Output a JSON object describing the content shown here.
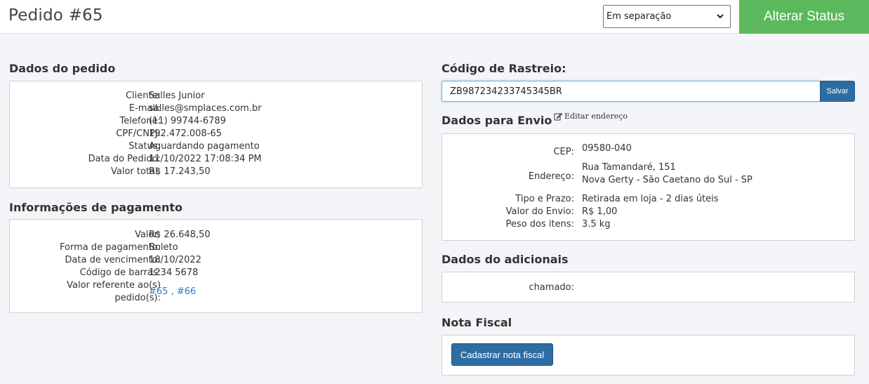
{
  "header": {
    "title": "Pedido #65",
    "status_selected": "Em separação",
    "status_button": "Alterar Status"
  },
  "order_data": {
    "title": "Dados do pedido",
    "rows": [
      {
        "label": "Cliente:",
        "value": "Salles Junior"
      },
      {
        "label": "E-mail:",
        "value": "salles@smplaces.com.br"
      },
      {
        "label": "Telefone:",
        "value": "(11) 99744-6789"
      },
      {
        "label": "CPF/CNPJ:",
        "value": "192.472.008-65"
      },
      {
        "label": "Status:",
        "value": "Aguardando pagamento"
      },
      {
        "label": "Data do Pedido:",
        "value": "11/10/2022 17:08:34 PM"
      },
      {
        "label": "Valor total:",
        "value": "R$ 17.243,50"
      }
    ]
  },
  "payment": {
    "title": "Informações de pagamento",
    "rows": [
      {
        "label": "Valor:",
        "value": "R$ 26.648,50"
      },
      {
        "label": "Forma de pagamento:",
        "value": "Boleto"
      },
      {
        "label": "Data de vencimento:",
        "value": "18/10/2022"
      },
      {
        "label": "Código de barras:",
        "value": "1234 5678"
      }
    ],
    "ref_label_1": "Valor referente ao(s)",
    "ref_label_2": "pedido(s):",
    "ref_link_1": "#65",
    "ref_sep": ",",
    "ref_link_2": "#66"
  },
  "tracking": {
    "title": "Código de Rastreio:",
    "value": "ZB987234233745345BR",
    "save_label": "Salvar"
  },
  "shipping": {
    "title": "Dados para Envio",
    "edit_label": "Editar endereço",
    "cep_label": "CEP:",
    "cep_value": "09580-040",
    "address_label": "Endereço:",
    "address_line1": "Rua Tamandaré, 151",
    "address_line2": "Nova Gerty - São Caetano do Sul - SP",
    "type_label": "Tipo e Prazo:",
    "type_value": "Retirada em loja - 2 dias úteis",
    "cost_label": "Valor do Envio:",
    "cost_value": "R$ 1,00",
    "weight_label": "Peso dos itens:",
    "weight_value": "3.5 kg"
  },
  "additional": {
    "title": "Dados do adicionais",
    "label": "chamado:",
    "value": ""
  },
  "invoice": {
    "title": "Nota Fiscal",
    "button_label": "Cadastrar nota fiscal"
  },
  "icons": {
    "chevron": "chevron-down-icon",
    "edit": "edit-icon"
  },
  "colors": {
    "primary": "#2e6da4",
    "success": "#5cb85c",
    "link": "#337ab7"
  }
}
